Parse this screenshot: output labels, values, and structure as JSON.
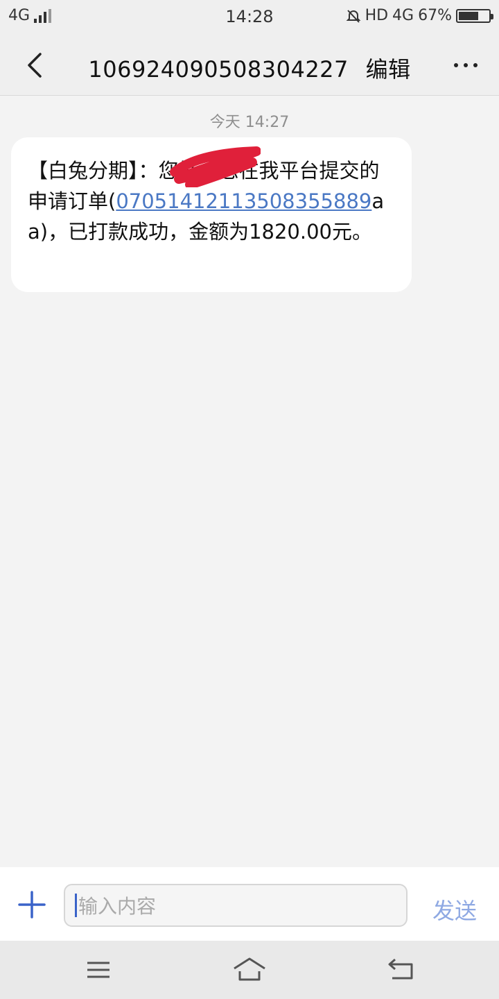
{
  "status_bar": {
    "network_left": "4G",
    "time": "14:28",
    "hd_label": "HD",
    "network_right": "4G",
    "battery_text": "67%",
    "battery_level": 0.67
  },
  "header": {
    "title": "106924090508304227",
    "edit_label": "编辑"
  },
  "conversation": {
    "timestamp": "今天 14:27",
    "message": {
      "prefix": "【白兔分期】",
      "part2": "：您好，您在我平台提交的申请订单(",
      "link": "07051412113508355889",
      "part3": "aa)，已打款成功，金额为1820.00元。"
    }
  },
  "input_bar": {
    "placeholder": "输入内容",
    "send_label": "发送"
  },
  "icons": {
    "back": "chevron-left-icon",
    "more": "more-dots-icon",
    "add": "plus-icon",
    "menu": "menu-icon",
    "home": "home-icon",
    "return": "back-arrow-icon"
  },
  "colors": {
    "link": "#4a78c4",
    "send": "#8fa9e3",
    "accent": "#3a63c9",
    "redaction": "#e0203a"
  }
}
